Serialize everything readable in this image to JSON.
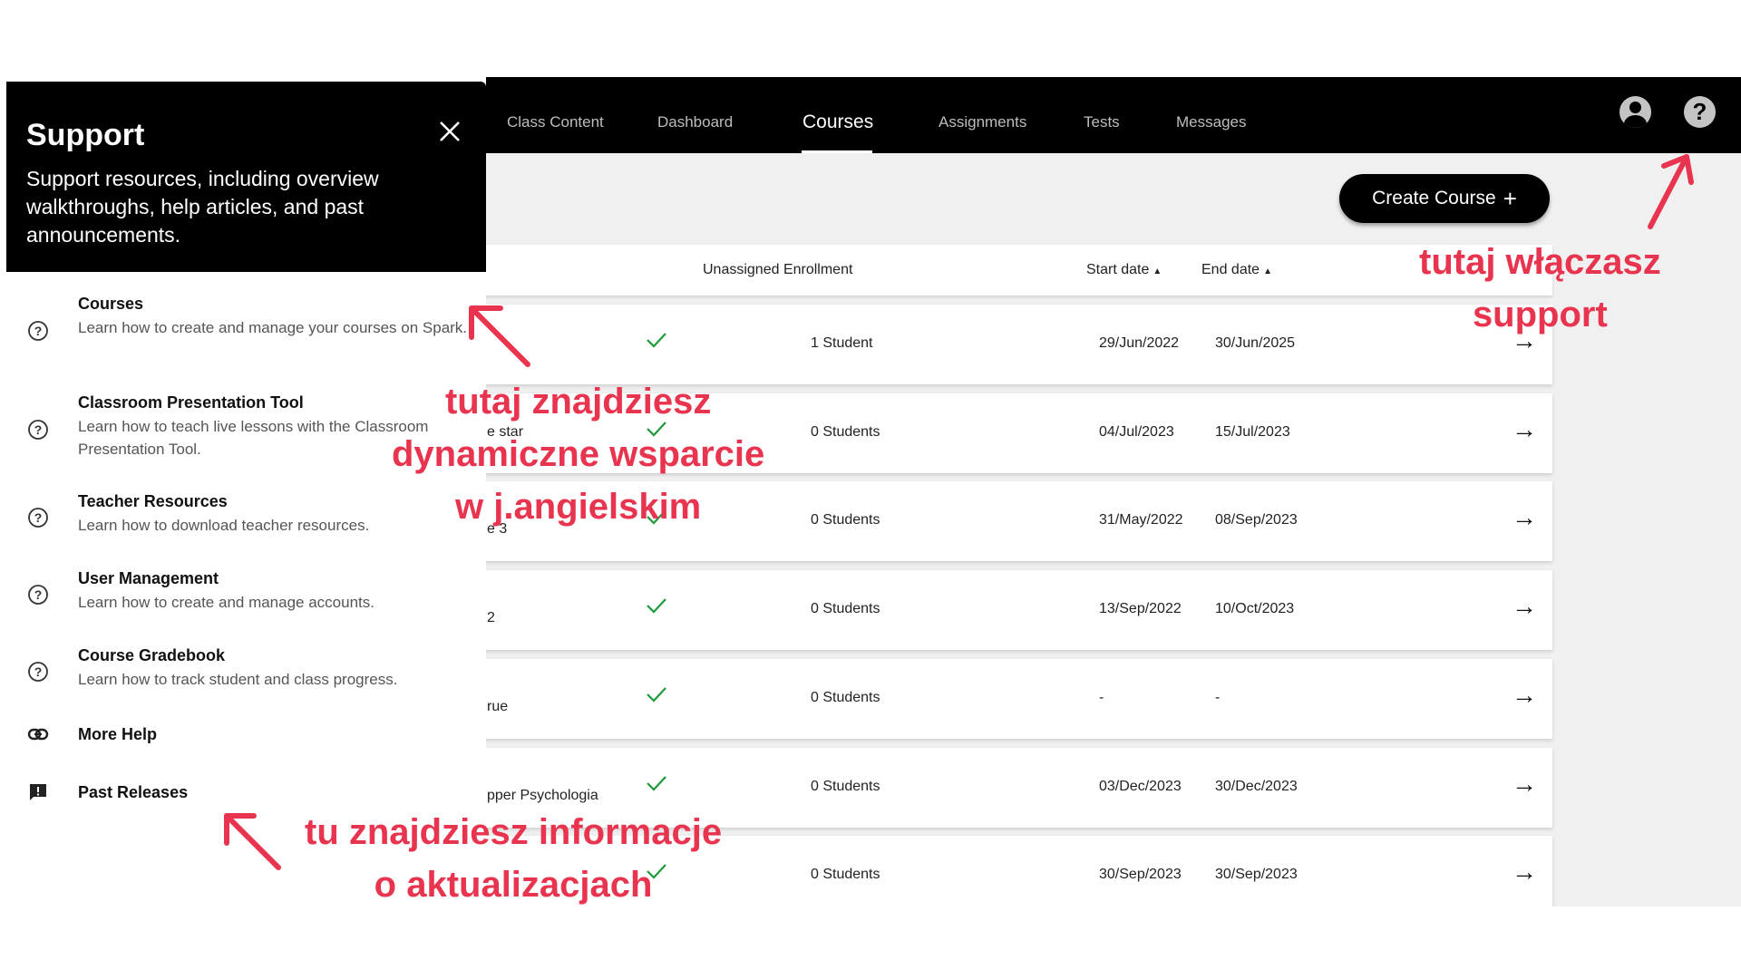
{
  "nav": {
    "items": [
      "Class Content",
      "Dashboard",
      "Courses",
      "Assignments",
      "Tests",
      "Messages"
    ],
    "active": "Courses"
  },
  "icons": {
    "user": "user-circle-icon",
    "help": "question-circle-icon",
    "close": "close-icon",
    "check": "check-icon",
    "arrow": "arrow-right-icon",
    "link": "link-icon",
    "releases": "chat-alert-icon"
  },
  "create_course": {
    "label": "Create Course",
    "plus": "+"
  },
  "table": {
    "headers": {
      "unassigned": "Unassigned Enrollment",
      "start": "Start date",
      "end": "End date",
      "sort_glyph": "▲"
    },
    "arrow_glyph": "→",
    "rows": [
      {
        "name": "",
        "students": "1 Student",
        "start": "29/Jun/2022",
        "end": "30/Jun/2025"
      },
      {
        "name": "e star",
        "students": "0 Students",
        "start": "04/Jul/2023",
        "end": "15/Jul/2023"
      },
      {
        "name": "e 3",
        "students": "0 Students",
        "start": "31/May/2022",
        "end": "08/Sep/2023"
      },
      {
        "name": "2",
        "students": "0 Students",
        "start": "13/Sep/2022",
        "end": "10/Oct/2023"
      },
      {
        "name": "rue",
        "students": "0 Students",
        "start": "-",
        "end": "-"
      },
      {
        "name": "pper Psychologia",
        "students": "0 Students",
        "start": "03/Dec/2023",
        "end": "30/Dec/2023"
      },
      {
        "name": "",
        "students": "0 Students",
        "start": "30/Sep/2023",
        "end": "30/Sep/2023"
      }
    ]
  },
  "support": {
    "title": "Support",
    "description": "Support resources, including overview walkthroughs, help articles, and past announcements.",
    "items": [
      {
        "title": "Courses",
        "desc": "Learn how to create and manage your courses on Spark."
      },
      {
        "title": "Classroom Presentation Tool",
        "desc": "Learn how to teach live lessons with the Classroom Presentation Tool."
      },
      {
        "title": "Teacher Resources",
        "desc": "Learn how to download teacher resources."
      },
      {
        "title": "User Management",
        "desc": "Learn how to create and manage accounts."
      },
      {
        "title": "Course Gradebook",
        "desc": "Learn how to track student and class progress."
      },
      {
        "title": "More Help",
        "desc": ""
      },
      {
        "title": "Past Releases",
        "desc": ""
      }
    ]
  },
  "annotations": {
    "support_toggle": [
      "tutaj włączasz",
      "support"
    ],
    "dynamic_help": [
      "tutaj znajdziesz",
      "dynamiczne wsparcie",
      "w j.angielskim"
    ],
    "updates": [
      "tu znajdziesz informacje",
      "o aktualizacjach"
    ],
    "color": "#e8344e"
  }
}
